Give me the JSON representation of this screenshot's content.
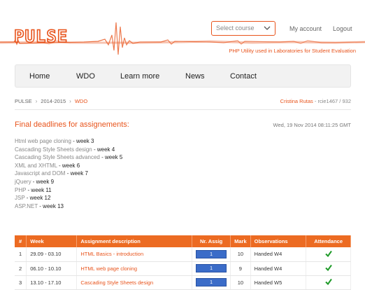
{
  "header": {
    "logo_text": "PULSE",
    "course_select": {
      "placeholder": "Select course",
      "value": "Select course"
    },
    "my_account": "My account",
    "logout": "Logout",
    "tagline": "PHP Utility used in Laboratories for Student Evaluation"
  },
  "nav": {
    "items": [
      {
        "label": "Home"
      },
      {
        "label": "WDO"
      },
      {
        "label": "Learn more"
      },
      {
        "label": "News"
      },
      {
        "label": "Contact"
      }
    ]
  },
  "breadcrumb": {
    "items": [
      "PULSE",
      "2014-2015",
      "WDO"
    ]
  },
  "user": {
    "name": "Cristina Rutas",
    "id": "rcie1467 / 932"
  },
  "deadlines": {
    "title": "Final deadlines for assignements:",
    "date": "Wed, 19 Nov 2014 08:11:25 GMT",
    "items": [
      {
        "subject": "Html web page cloning",
        "week": "week 3"
      },
      {
        "subject": "Cascading Style Sheets design",
        "week": "week 4"
      },
      {
        "subject": "Cascading Style Sheets advanced",
        "week": "week 5"
      },
      {
        "subject": "XML and XHTML",
        "week": "week 6"
      },
      {
        "subject": "Javascript and DOM",
        "week": "week 7"
      },
      {
        "subject": "jQuery",
        "week": "week 9"
      },
      {
        "subject": "PHP",
        "week": "week 11"
      },
      {
        "subject": "JSP",
        "week": "week 12"
      },
      {
        "subject": "ASP.NET",
        "week": "week 13"
      }
    ]
  },
  "table": {
    "headers": [
      "#",
      "Week",
      "Assignment description",
      "Nr. Assig",
      "Mark",
      "Observations",
      "Attendance"
    ],
    "rows": [
      {
        "num": "1",
        "week": "29.09 - 03.10",
        "desc": "HTML Basics - introduction",
        "assig": "1",
        "mark": "10",
        "obs": "Handed W4",
        "attendance": true
      },
      {
        "num": "2",
        "week": "06.10 - 10.10",
        "desc": "HTML web page cloning",
        "assig": "1",
        "mark": "9",
        "obs": "Handed W4",
        "attendance": true
      },
      {
        "num": "3",
        "week": "13.10 - 17.10",
        "desc": "Cascading Style Sheets design",
        "assig": "1",
        "mark": "10",
        "obs": "Handed W5",
        "attendance": true
      }
    ]
  },
  "colors": {
    "accent": "#e8541c",
    "table_header": "#ec6b22",
    "assig_button": "#3b6cc8",
    "check": "#1e9a28"
  }
}
